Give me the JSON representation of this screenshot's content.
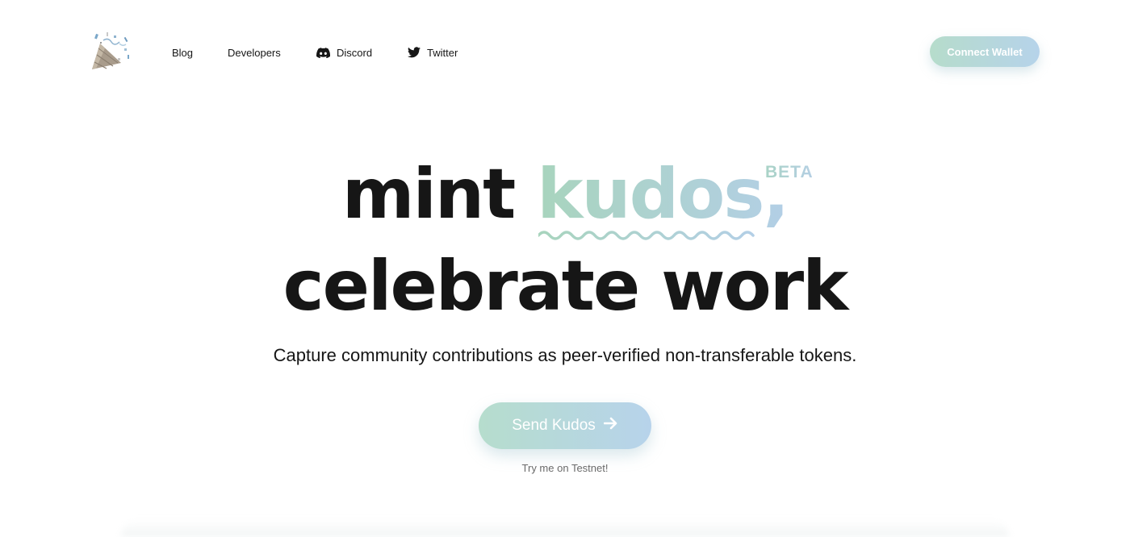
{
  "nav": {
    "logo_icon": "party-popper-icon",
    "links": {
      "blog": "Blog",
      "developers": "Developers",
      "discord": "Discord",
      "twitter": "Twitter"
    },
    "connect_wallet": "Connect Wallet"
  },
  "hero": {
    "line1_prefix": "mint ",
    "line1_highlight": "kudos,",
    "beta_badge": "BETA",
    "line2": "celebrate work",
    "subtitle": "Capture community contributions as peer-verified non-transferable tokens.",
    "cta_label": "Send Kudos",
    "cta_icon": "arrow-right-icon",
    "cta_note": "Try me on Testnet!"
  },
  "colors": {
    "gradient_start": "#b6dccb",
    "gradient_end": "#b6d3ea",
    "text": "#161616"
  }
}
